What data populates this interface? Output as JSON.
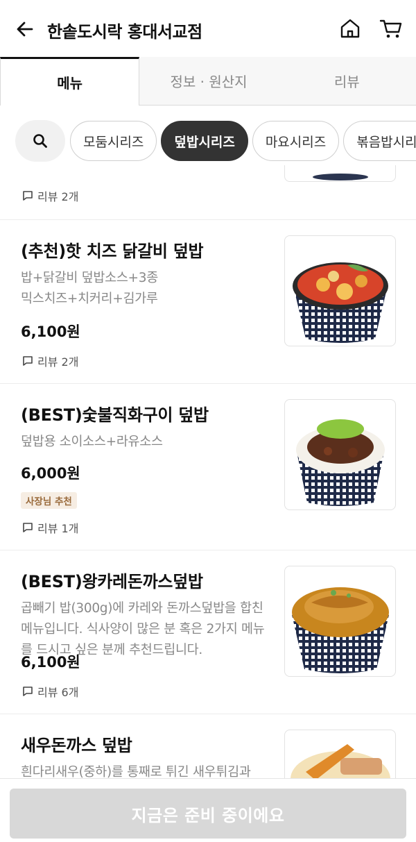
{
  "header": {
    "title": "한솥도시락 홍대서교점",
    "back_icon": "arrow-left-icon",
    "home_icon": "home-icon",
    "cart_icon": "cart-icon"
  },
  "tabs": [
    {
      "label": "메뉴",
      "active": true
    },
    {
      "label": "정보 · 원산지",
      "active": false
    },
    {
      "label": "리뷰",
      "active": false
    }
  ],
  "categories": [
    {
      "label": "모둠시리즈",
      "active": false
    },
    {
      "label": "덮밥시리즈",
      "active": true
    },
    {
      "label": "마요시리즈",
      "active": false
    },
    {
      "label": "볶음밥시리즈",
      "active": false
    }
  ],
  "previous_item": {
    "review": "리뷰 2개"
  },
  "items": [
    {
      "name": "(추천)핫 치즈 닭갈비 덮밥",
      "desc_lines": [
        "밥+닭갈비 덮밥소스+3종",
        "믹스치즈+치커리+김가루"
      ],
      "price": "6,100원",
      "review": "리뷰 2개"
    },
    {
      "name": "(BEST)숯불직화구이 덮밥",
      "desc_lines": [
        "덮밥용 소이소스+라유소스"
      ],
      "price": "6,000원",
      "badge": "사장님 추천",
      "review": "리뷰 1개"
    },
    {
      "name": "(BEST)왕카레돈까스덮밥",
      "desc_lines": [
        "곱빼기 밥(300g)에 카레와 돈까스덮밥을 합친",
        "메뉴입니다. 식사양이 많은 분 혹은 2가지 메뉴를 드시고 싶은 분께 추천드립니다."
      ],
      "price": "6,100원",
      "review": "리뷰 6개"
    },
    {
      "name": "새우돈까스 덮밥",
      "desc_lines": [
        "흰다리새우(중하)를 통째로 튀긴 새우튀김과"
      ]
    }
  ],
  "footer": {
    "order_button": "지금은 준비 중이에요",
    "enabled": false
  },
  "colors": {
    "active_chip": "#333333",
    "disabled_button": "#d8d8d8",
    "badge_bg": "#f6ede3",
    "badge_text": "#9a6b3c"
  }
}
